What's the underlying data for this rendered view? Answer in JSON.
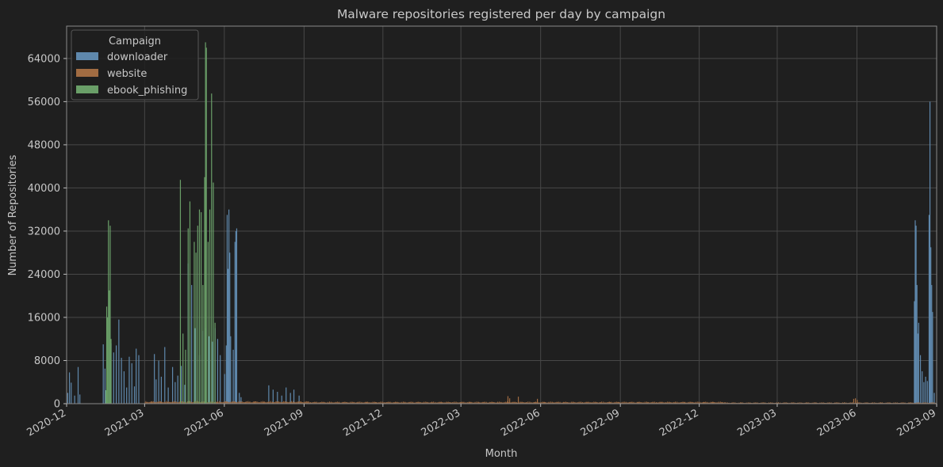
{
  "chart_data": {
    "type": "bar",
    "stacked": true,
    "title": "Malware repositories registered per day by campaign",
    "xlabel": "Month",
    "ylabel": "Number of Repositories",
    "x_range": [
      "2020-12-01",
      "2023-09-01"
    ],
    "ylim": [
      0,
      70000
    ],
    "y_ticks": [
      0,
      8000,
      16000,
      24000,
      32000,
      40000,
      48000,
      56000,
      64000
    ],
    "x_ticks": [
      {
        "label": "2020-12",
        "date": "2020-12-01"
      },
      {
        "label": "2021-03",
        "date": "2021-03-01"
      },
      {
        "label": "2021-06",
        "date": "2021-06-01"
      },
      {
        "label": "2021-09",
        "date": "2021-09-01"
      },
      {
        "label": "2021-12",
        "date": "2021-12-01"
      },
      {
        "label": "2022-03",
        "date": "2022-03-01"
      },
      {
        "label": "2022-06",
        "date": "2022-06-01"
      },
      {
        "label": "2022-09",
        "date": "2022-09-01"
      },
      {
        "label": "2022-12",
        "date": "2022-12-01"
      },
      {
        "label": "2023-03",
        "date": "2023-03-01"
      },
      {
        "label": "2023-06",
        "date": "2023-06-01"
      },
      {
        "label": "2023-09",
        "date": "2023-09-01"
      }
    ],
    "grid": true,
    "legend": {
      "title": "Campaign",
      "position": "top-left"
    },
    "series": [
      {
        "name": "downloader",
        "color": "#5f88ac",
        "points": [
          [
            "2020-12-02",
            2000
          ],
          [
            "2020-12-04",
            5800
          ],
          [
            "2020-12-06",
            3900
          ],
          [
            "2020-12-10",
            1500
          ],
          [
            "2020-12-14",
            6800
          ],
          [
            "2020-12-16",
            1700
          ],
          [
            "2021-01-12",
            11000
          ],
          [
            "2021-01-14",
            6500
          ],
          [
            "2021-01-21",
            11200
          ],
          [
            "2021-01-24",
            9500
          ],
          [
            "2021-01-27",
            10800
          ],
          [
            "2021-01-30",
            15600
          ],
          [
            "2021-02-02",
            8500
          ],
          [
            "2021-02-05",
            6000
          ],
          [
            "2021-02-08",
            3000
          ],
          [
            "2021-02-11",
            8700
          ],
          [
            "2021-02-14",
            7500
          ],
          [
            "2021-02-17",
            3200
          ],
          [
            "2021-02-19",
            10200
          ],
          [
            "2021-02-22",
            9000
          ],
          [
            "2021-03-12",
            9200
          ],
          [
            "2021-03-14",
            4500
          ],
          [
            "2021-03-17",
            8000
          ],
          [
            "2021-03-20",
            5000
          ],
          [
            "2021-03-24",
            10500
          ],
          [
            "2021-03-28",
            3000
          ],
          [
            "2021-04-02",
            6800
          ],
          [
            "2021-04-05",
            4000
          ],
          [
            "2021-04-08",
            5200
          ],
          [
            "2021-04-12",
            7000
          ],
          [
            "2021-04-16",
            3500
          ],
          [
            "2021-04-20",
            26000
          ],
          [
            "2021-04-24",
            22000
          ],
          [
            "2021-04-28",
            14000
          ],
          [
            "2021-05-03",
            9000
          ],
          [
            "2021-05-07",
            13500
          ],
          [
            "2021-05-10",
            14000
          ],
          [
            "2021-05-14",
            12500
          ],
          [
            "2021-05-18",
            11500
          ],
          [
            "2021-05-21",
            14000
          ],
          [
            "2021-05-24",
            12000
          ],
          [
            "2021-05-27",
            9000
          ],
          [
            "2021-06-01",
            5500
          ],
          [
            "2021-06-03",
            10800
          ],
          [
            "2021-06-04",
            35000
          ],
          [
            "2021-06-05",
            25000
          ],
          [
            "2021-06-06",
            36000
          ],
          [
            "2021-06-07",
            28000
          ],
          [
            "2021-06-08",
            12500
          ],
          [
            "2021-06-11",
            10000
          ],
          [
            "2021-06-13",
            30000
          ],
          [
            "2021-06-14",
            32000
          ],
          [
            "2021-06-15",
            32500
          ],
          [
            "2021-06-18",
            2000
          ],
          [
            "2021-06-20",
            1200
          ],
          [
            "2021-07-22",
            3400
          ],
          [
            "2021-07-27",
            2600
          ],
          [
            "2021-08-01",
            2200
          ],
          [
            "2021-08-06",
            1500
          ],
          [
            "2021-08-11",
            3000
          ],
          [
            "2021-08-16",
            2000
          ],
          [
            "2021-08-20",
            2600
          ],
          [
            "2021-08-26",
            1500
          ],
          [
            "2023-08-06",
            19000
          ],
          [
            "2023-08-07",
            34000
          ],
          [
            "2023-08-08",
            33000
          ],
          [
            "2023-08-09",
            22000
          ],
          [
            "2023-08-10",
            13000
          ],
          [
            "2023-08-11",
            15000
          ],
          [
            "2023-08-13",
            9000
          ],
          [
            "2023-08-15",
            6000
          ],
          [
            "2023-08-17",
            4000
          ],
          [
            "2023-08-19",
            5000
          ],
          [
            "2023-08-21",
            4200
          ],
          [
            "2023-08-23",
            35000
          ],
          [
            "2023-08-24",
            56000
          ],
          [
            "2023-08-25",
            29000
          ],
          [
            "2023-08-26",
            22000
          ],
          [
            "2023-08-27",
            17000
          ],
          [
            "2023-08-29",
            2000
          ]
        ]
      },
      {
        "name": "website",
        "color": "#a16c42",
        "bands": [
          {
            "start": "2021-03-01",
            "end": "2021-09-05",
            "base": 250,
            "amp": 250
          },
          {
            "start": "2021-09-05",
            "end": "2022-12-31",
            "base": 200,
            "amp": 200
          },
          {
            "start": "2023-01-01",
            "end": "2023-08-31",
            "base": 120,
            "amp": 160
          }
        ],
        "points": [
          [
            "2022-04-24",
            1400
          ],
          [
            "2022-04-26",
            1000
          ],
          [
            "2022-05-06",
            1300
          ],
          [
            "2022-05-28",
            900
          ],
          [
            "2023-05-28",
            900
          ],
          [
            "2023-05-30",
            1000
          ],
          [
            "2023-06-01",
            700
          ]
        ]
      },
      {
        "name": "ebook_phishing",
        "color": "#6a9f68",
        "points": [
          [
            "2021-01-15",
            2500
          ],
          [
            "2021-01-16",
            18000
          ],
          [
            "2021-01-17",
            16000
          ],
          [
            "2021-01-18",
            34000
          ],
          [
            "2021-01-19",
            21000
          ],
          [
            "2021-01-20",
            33000
          ],
          [
            "2021-01-21",
            12000
          ],
          [
            "2021-04-11",
            41500
          ],
          [
            "2021-04-14",
            13000
          ],
          [
            "2021-04-17",
            10000
          ],
          [
            "2021-04-20",
            32500
          ],
          [
            "2021-04-22",
            37500
          ],
          [
            "2021-04-27",
            30000
          ],
          [
            "2021-04-29",
            28000
          ],
          [
            "2021-05-01",
            33000
          ],
          [
            "2021-05-03",
            36000
          ],
          [
            "2021-05-05",
            35500
          ],
          [
            "2021-05-07",
            22000
          ],
          [
            "2021-05-09",
            42000
          ],
          [
            "2021-05-10",
            67000
          ],
          [
            "2021-05-11",
            66000
          ],
          [
            "2021-05-13",
            30000
          ],
          [
            "2021-05-15",
            36000
          ],
          [
            "2021-05-17",
            57500
          ],
          [
            "2021-05-19",
            41000
          ],
          [
            "2021-05-21",
            15000
          ]
        ]
      }
    ]
  }
}
